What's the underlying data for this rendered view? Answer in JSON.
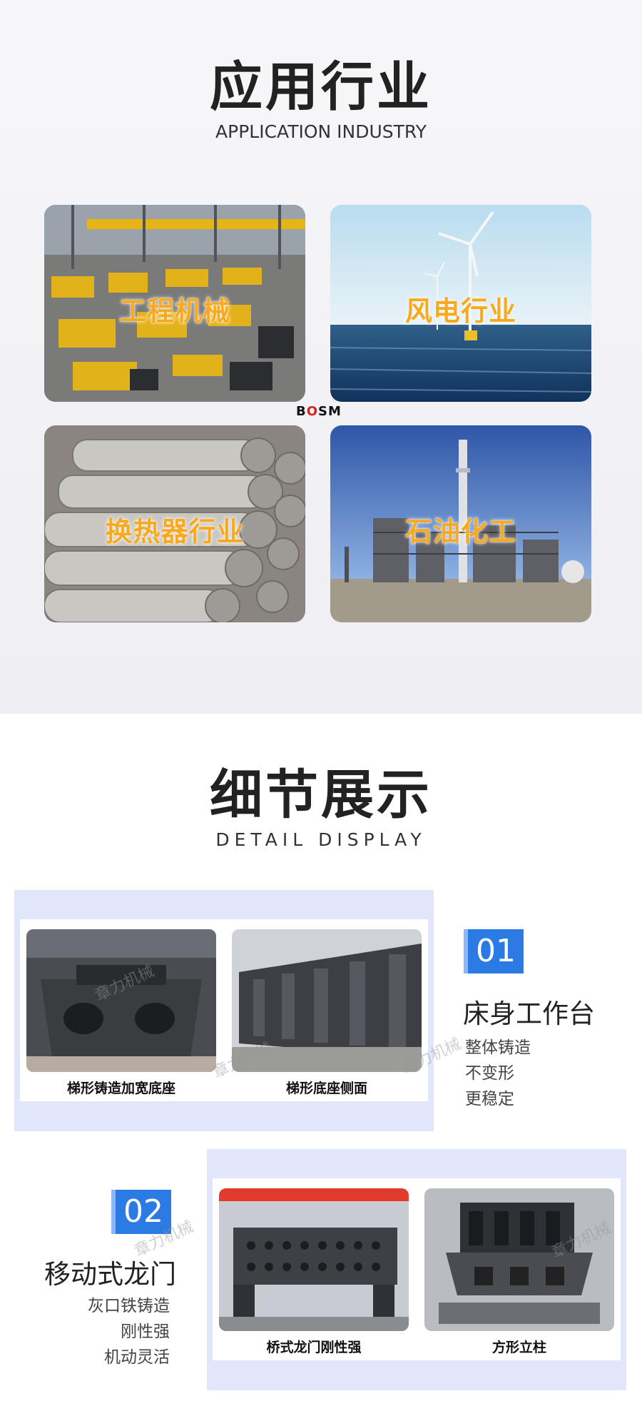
{
  "section1": {
    "title_cn": "应用行业",
    "title_en": "APPLICATION INDUSTRY",
    "tiles": [
      {
        "label": "工程机械",
        "icon": "factory-floor-photo"
      },
      {
        "label": "风电行业",
        "icon": "offshore-wind-photo"
      },
      {
        "label": "换热器行业",
        "icon": "heat-exchanger-tubes-photo"
      },
      {
        "label": "石油化工",
        "icon": "petrochemical-plant-photo"
      }
    ],
    "logo": {
      "prefix": "B",
      "accent": "O",
      "suffix": "SM"
    }
  },
  "section2": {
    "title_cn": "细节展示",
    "title_en": "DETAIL DISPLAY",
    "detail1": {
      "number": "01",
      "subtitle": "床身工作台",
      "features": [
        "整体铸造",
        "不变形",
        "更稳定"
      ],
      "captions": [
        "梯形铸造加宽底座",
        "梯形底座侧面"
      ]
    },
    "detail2": {
      "number": "02",
      "subtitle": "移动式龙门",
      "features": [
        "灰口铁铸造",
        "刚性强",
        "机动灵活"
      ],
      "captions": [
        "桥式龙门刚性强",
        "方形立柱"
      ]
    },
    "watermark": "章力机械"
  },
  "colors": {
    "accent_blue": "#2c7be5",
    "label_orange": "#f7a91f",
    "panel_blue": "#e1e6fb"
  }
}
